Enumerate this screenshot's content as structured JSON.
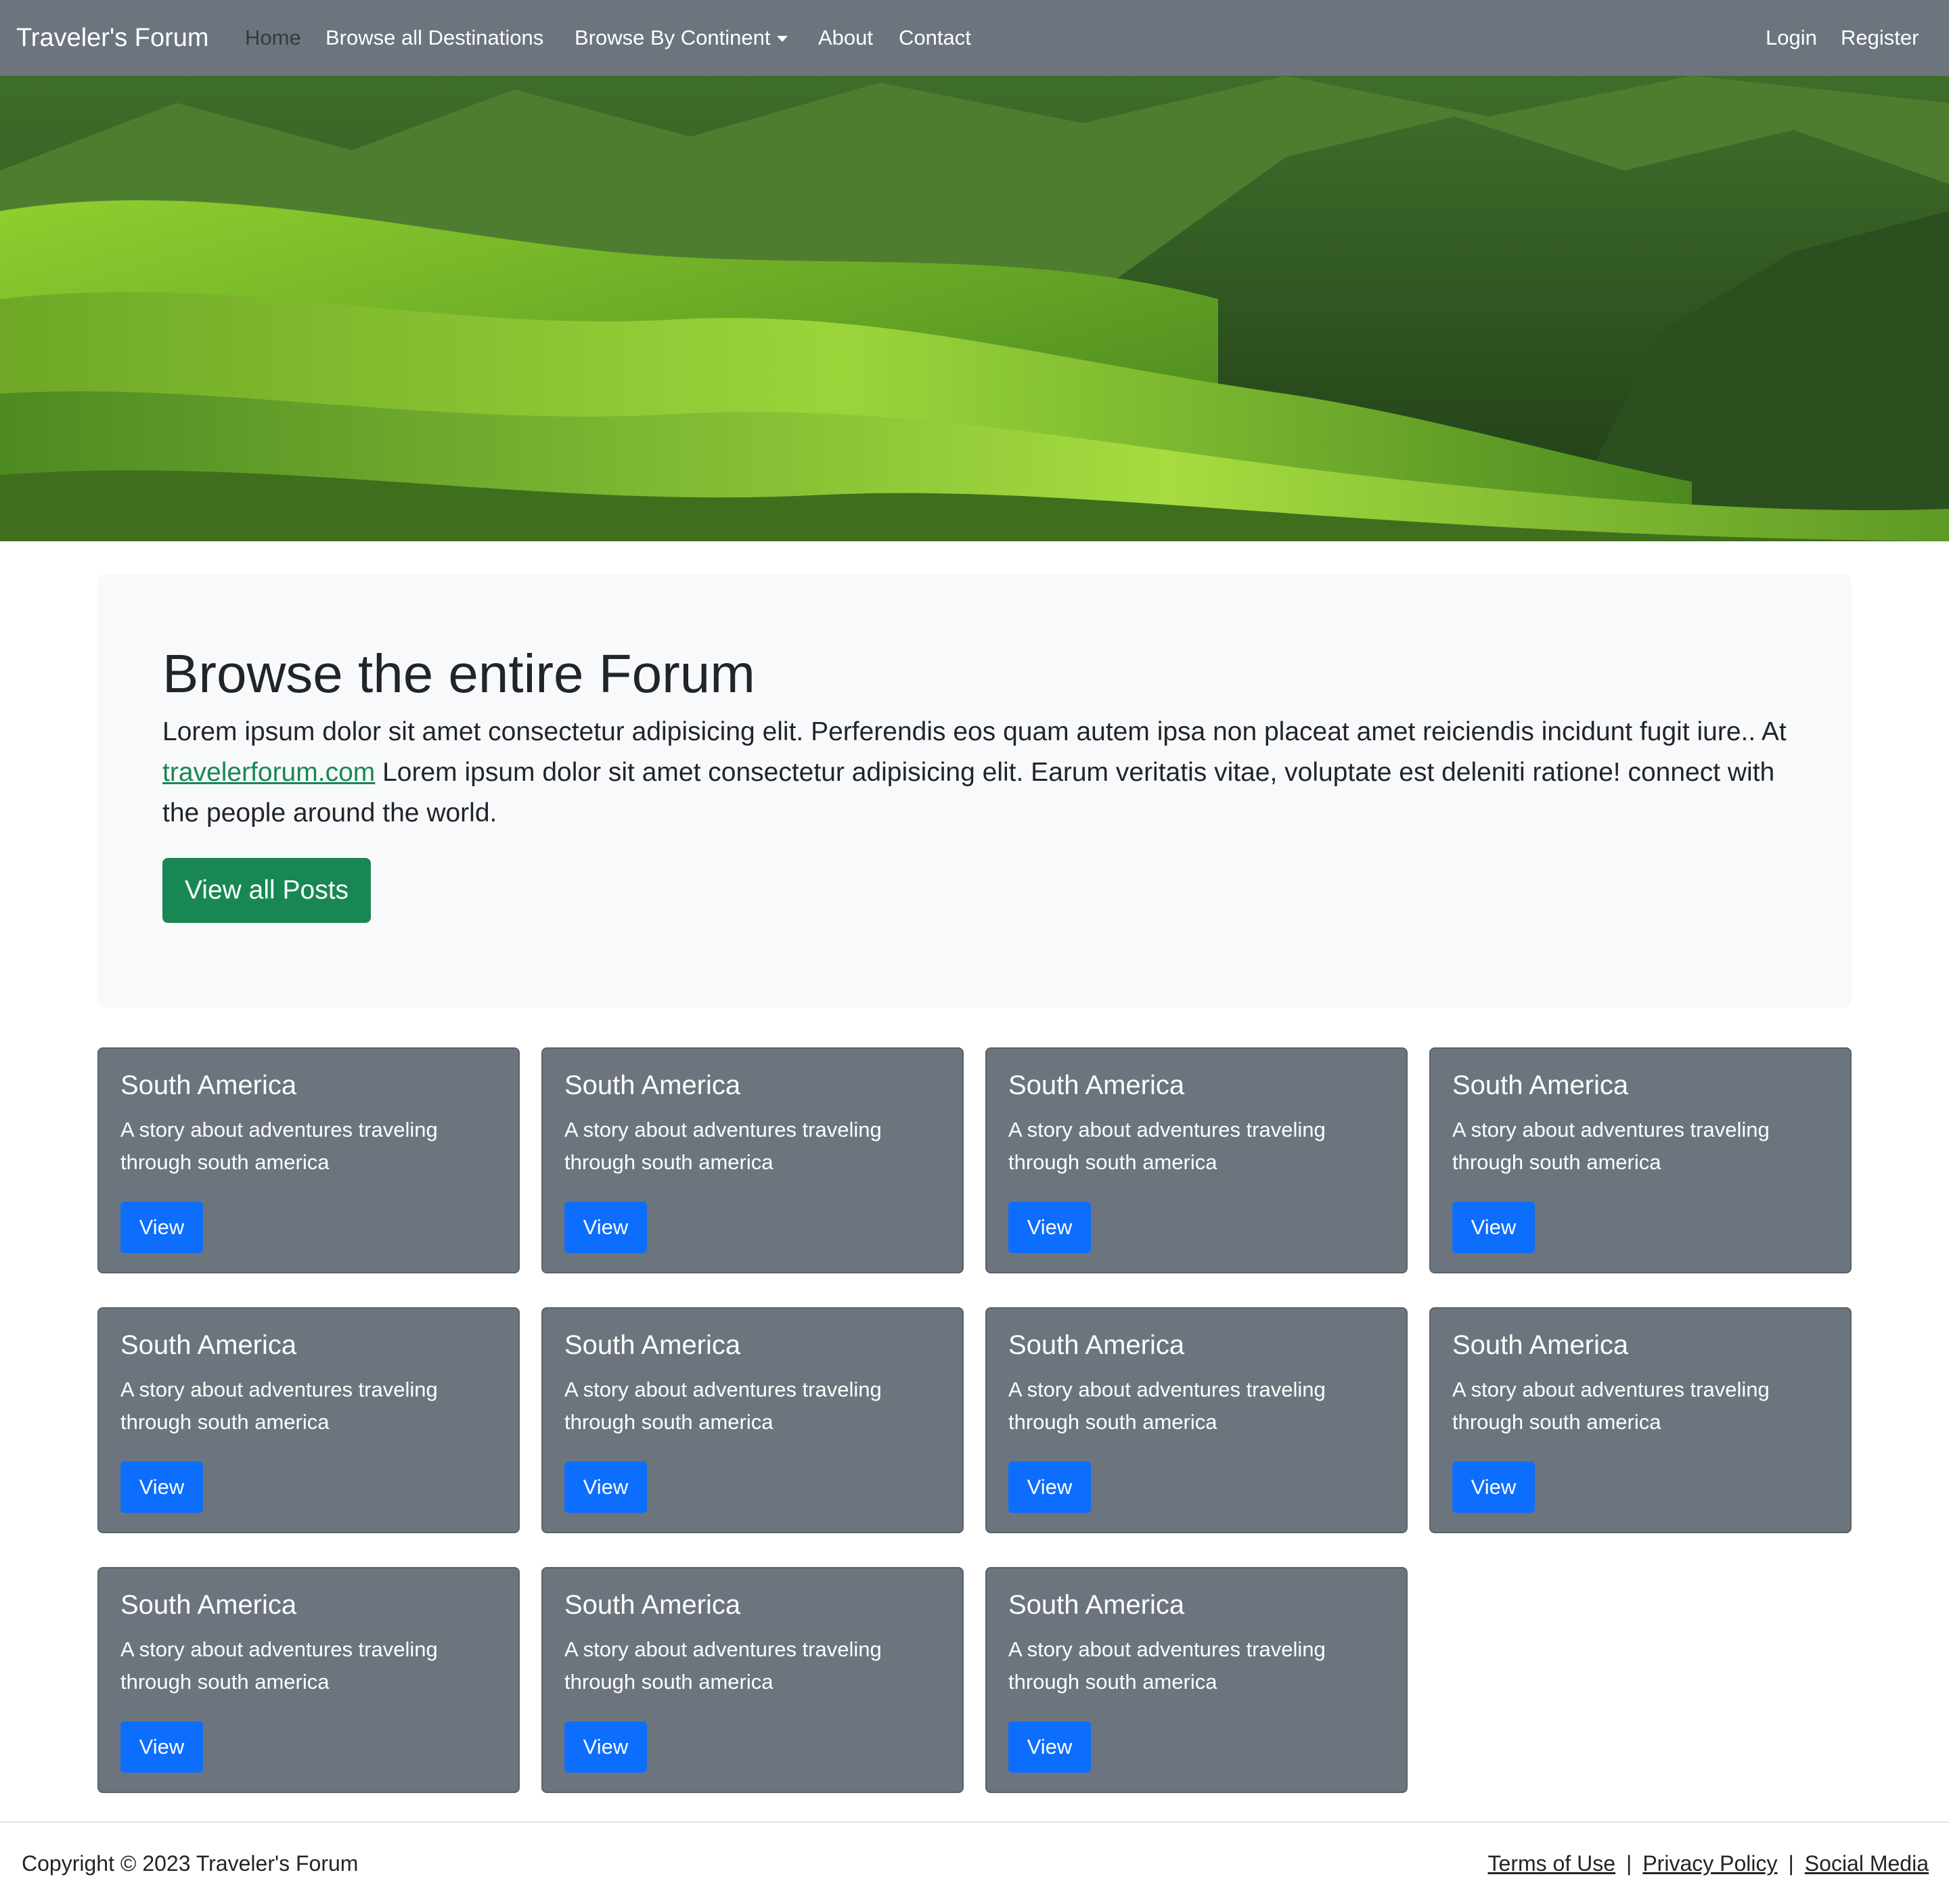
{
  "navbar": {
    "brand": "Traveler's Forum",
    "links": [
      {
        "label": "Home",
        "active": true
      },
      {
        "label": "Browse all Destinations"
      },
      {
        "label": "Browse By Continent"
      },
      {
        "label": "About"
      },
      {
        "label": "Contact"
      }
    ],
    "right_links": [
      {
        "label": "Login"
      },
      {
        "label": "Register"
      }
    ]
  },
  "hero": {
    "image": "green rolling hills landscape"
  },
  "jumbotron": {
    "title": "Browse the entire Forum",
    "text_before": "Lorem ipsum dolor sit amet consectetur adipisicing elit. Perferendis eos quam autem ipsa non placeat amet reiciendis incidunt fugit iure.. At ",
    "link": "travelerforum.com",
    "text_after": " Lorem ipsum dolor sit amet consectetur adipisicing elit. Earum veritatis vitae, voluptate est deleniti ratione! connect with the people around the world.",
    "button": "View all Posts"
  },
  "cards": [
    {
      "title": "South America",
      "text": "A story about adventures traveling through south america",
      "button": "View"
    },
    {
      "title": "South America",
      "text": "A story about adventures traveling through south america",
      "button": "View"
    },
    {
      "title": "South America",
      "text": "A story about adventures traveling through south america",
      "button": "View"
    },
    {
      "title": "South America",
      "text": "A story about adventures traveling through south america",
      "button": "View"
    },
    {
      "title": "South America",
      "text": "A story about adventures traveling through south america",
      "button": "View"
    },
    {
      "title": "South America",
      "text": "A story about adventures traveling through south america",
      "button": "View"
    },
    {
      "title": "South America",
      "text": "A story about adventures traveling through south america",
      "button": "View"
    },
    {
      "title": "South America",
      "text": "A story about adventures traveling through south america",
      "button": "View"
    },
    {
      "title": "South America",
      "text": "A story about adventures traveling through south america",
      "button": "View"
    },
    {
      "title": "South America",
      "text": "A story about adventures traveling through south america",
      "button": "View"
    },
    {
      "title": "South America",
      "text": "A story about adventures traveling through south america",
      "button": "View"
    }
  ],
  "footer": {
    "copyright": "Copyright © 2023 Traveler's Forum",
    "links": [
      "Terms of Use",
      "Privacy Policy",
      "Social Media"
    ],
    "separator": "|"
  },
  "colors": {
    "navbar": "#6c757d",
    "nav_active": "#343a40",
    "jumbotron_bg": "#f8f9fa",
    "primary_green": "#198754",
    "primary_blue": "#0d6efd",
    "card_bg": "#6c757d"
  }
}
